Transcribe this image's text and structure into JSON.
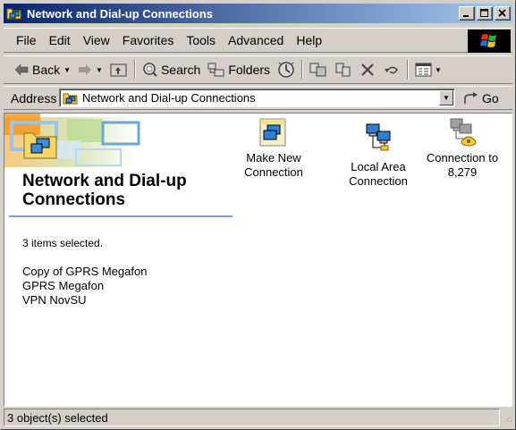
{
  "window": {
    "title": "Network and Dial-up Connections",
    "title_icon": "network-folder-icon",
    "controls": {
      "minimize": "minimize-icon",
      "maximize": "maximize-icon",
      "close": "close-icon"
    },
    "colors": {
      "title_start": "#0a246a",
      "title_end": "#a6caf0",
      "face": "#d4d0c8",
      "heading_rule": "#7d9fd0"
    }
  },
  "menubar": {
    "items": [
      "File",
      "Edit",
      "View",
      "Favorites",
      "Tools",
      "Advanced",
      "Help"
    ],
    "logo": "windows-flag-icon"
  },
  "toolbar": {
    "back_label": "Back",
    "forward_icon": "forward-arrow-icon",
    "up_icon": "up-folder-icon",
    "search_label": "Search",
    "folders_label": "Folders",
    "history_icon": "history-icon",
    "move_to_icon": "move-to-icon",
    "copy_to_icon": "copy-to-icon",
    "delete_icon": "delete-icon",
    "undo_icon": "undo-icon",
    "views_icon": "views-icon"
  },
  "addressbar": {
    "label": "Address",
    "value": "Network and Dial-up Connections",
    "go_label": "Go"
  },
  "content": {
    "heading": "Network and Dial-up Connections",
    "selection_count": "3 items selected.",
    "selected_items": [
      "Copy of GPRS Megafon",
      "GPRS Megafon",
      "VPN NovSU"
    ],
    "icons": [
      {
        "label": "Make New Connection",
        "icon": "make-new-connection-icon"
      },
      {
        "label": "Local Area Connection",
        "icon": "local-area-connection-icon"
      },
      {
        "label": "Connection to 8,279",
        "icon": "dialup-connection-icon"
      }
    ]
  },
  "statusbar": {
    "text": "3 object(s) selected"
  }
}
